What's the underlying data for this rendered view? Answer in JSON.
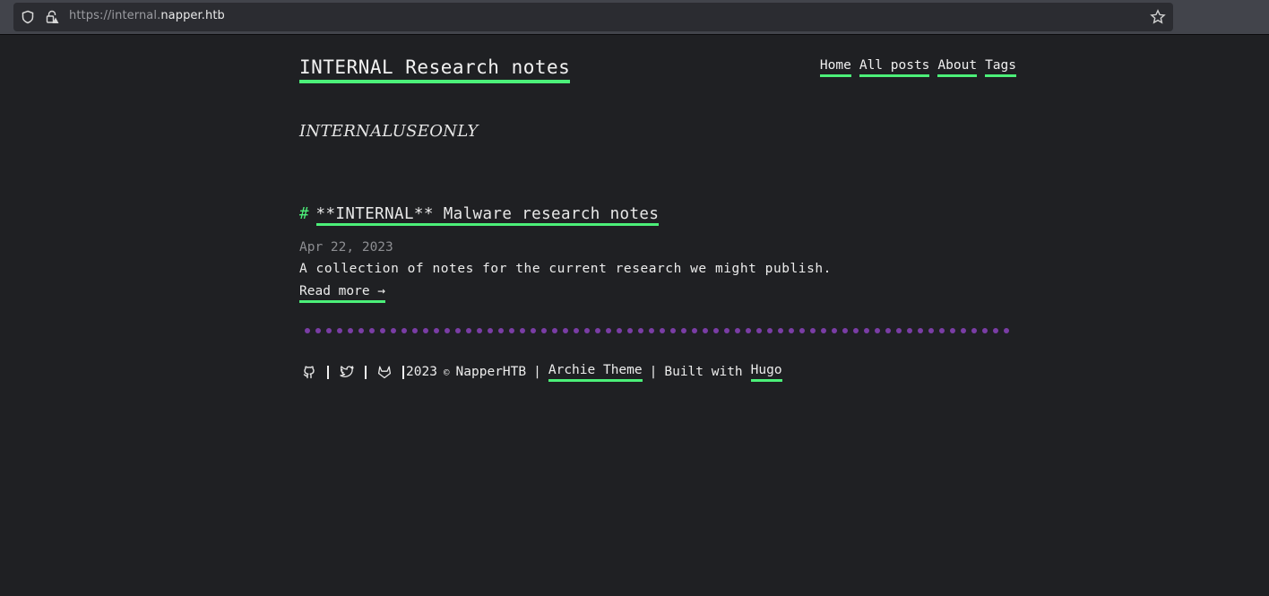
{
  "browser": {
    "url_scheme_prefix": "https://internal.",
    "url_host": "napper.htb",
    "icons": {
      "tracking": "shield-icon",
      "security": "lock-warning-icon",
      "bookmark": "star-icon"
    }
  },
  "header": {
    "site_title": "INTERNAL Research notes",
    "nav": [
      {
        "label": "Home"
      },
      {
        "label": "All posts"
      },
      {
        "label": "About"
      },
      {
        "label": "Tags"
      }
    ]
  },
  "subtitle": "INTERNALUSEONLY",
  "posts": [
    {
      "hash": "#",
      "title": "**INTERNAL** Malware research notes",
      "date": "Apr 22, 2023",
      "summary": "A collection of notes for the current research we might publish.",
      "read_more": "Read more →"
    }
  ],
  "footer": {
    "social_icons": [
      "github-icon",
      "twitter-icon",
      "gitlab-icon"
    ],
    "year": "2023",
    "copyright_symbol": "©",
    "owner": "NapperHTB",
    "separator": "|",
    "theme_link": "Archie Theme",
    "built_with_text": "Built with",
    "hugo_link": "Hugo"
  },
  "colors": {
    "accent": "#4cf079",
    "divider_dots": "#7a3da5",
    "background": "#1f2023"
  }
}
